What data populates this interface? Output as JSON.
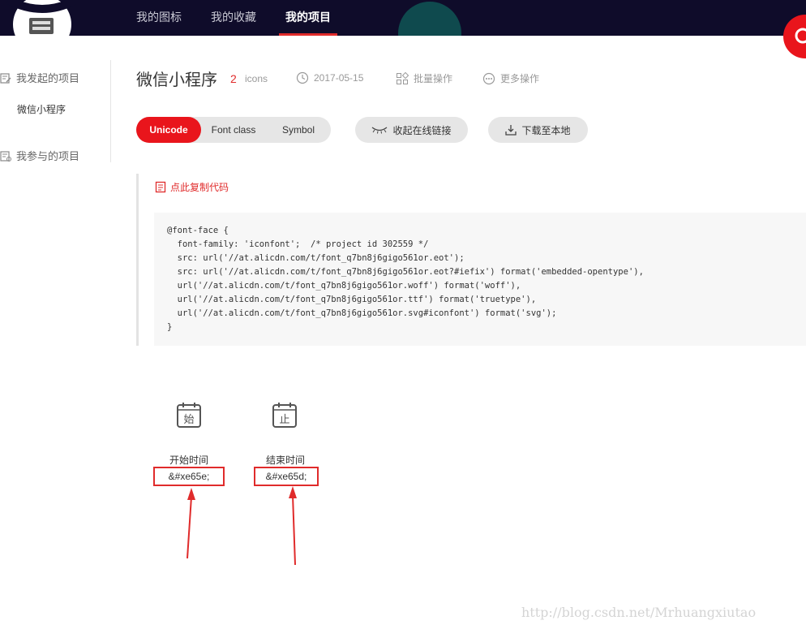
{
  "nav": {
    "items": [
      "我的图标",
      "我的收藏",
      "我的项目"
    ],
    "active_index": 2
  },
  "sidebar": {
    "initiated_label": "我发起的项目",
    "project_item": "微信小程序",
    "joined_label": "我参与的项目"
  },
  "project": {
    "title": "微信小程序",
    "icon_count": "2",
    "icon_unit": "icons",
    "date": "2017-05-15",
    "batch_action": "批量操作",
    "more_action": "更多操作"
  },
  "tabs": {
    "items": [
      "Unicode",
      "Font class",
      "Symbol"
    ],
    "active": "Unicode"
  },
  "buttons": {
    "collapse_link": "收起在线链接",
    "download": "下载至本地"
  },
  "code": {
    "copy_label": "点此复制代码",
    "lines": [
      "@font-face {",
      "  font-family: 'iconfont';  /* project id 302559 */",
      "  src: url('//at.alicdn.com/t/font_q7bn8j6gigo561or.eot');",
      "  src: url('//at.alicdn.com/t/font_q7bn8j6gigo561or.eot?#iefix') format('embedded-opentype'),",
      "  url('//at.alicdn.com/t/font_q7bn8j6gigo561or.woff') format('woff'),",
      "  url('//at.alicdn.com/t/font_q7bn8j6gigo561or.ttf') format('truetype'),",
      "  url('//at.alicdn.com/t/font_q7bn8j6gigo561or.svg#iconfont') format('svg');",
      "}"
    ]
  },
  "icons": [
    {
      "name": "开始时间",
      "code": "&#xe65e;",
      "glyph_char": "始"
    },
    {
      "name": "结束时间",
      "code": "&#xe65d;",
      "glyph_char": "止"
    }
  ],
  "watermark": "http://blog.csdn.net/Mrhuangxiutao",
  "colors": {
    "accent": "#e9151c",
    "nav_bg": "#0f0c2a",
    "annotation": "#e02b2b"
  }
}
